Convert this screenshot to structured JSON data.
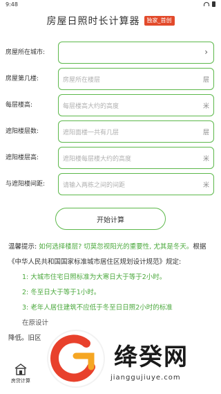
{
  "status_bar": {
    "time": "9:48"
  },
  "header": {
    "title": "房屋日照时长计算器",
    "badge": "独家_首创"
  },
  "form": {
    "rows": [
      {
        "label": "房屋所在城市:",
        "placeholder": "",
        "unit": "",
        "chevron": "›"
      },
      {
        "label": "房屋第几楼:",
        "placeholder": "房屋所在楼层",
        "unit": "层"
      },
      {
        "label": "每层楼高:",
        "placeholder": "每层楼高大约的高度",
        "unit": "米"
      },
      {
        "label": "遮阳楼层数:",
        "placeholder": "遮阳面楼一共有几层",
        "unit": "层"
      },
      {
        "label": "遮阳楼层高:",
        "placeholder": "遮阳楼每层楼大约的高度",
        "unit": "米"
      },
      {
        "label": "与遮阳楼间距:",
        "placeholder": "请输入两栋之间的间距",
        "unit": "米"
      }
    ],
    "submit_label": "开始计算"
  },
  "tips": {
    "prefix": "温馨提示: ",
    "highlight": "如何选择楼层? 切莫忽视阳光的重要性, 尤其是冬天。",
    "body": "根据《中华人民共和国国家标准城市居住区规划设计规范》规定:",
    "items": [
      "1: 大城市住宅日照标准为大寒日大于等于2小时。",
      "2: 冬至日大于等于1小时。",
      "3: 老年人居住建筑不应低于冬至日日照2小时的标准"
    ],
    "tail": "在原设计",
    "tail2": "降低。旧区"
  },
  "bottom_nav": {
    "item_label": "房贷计算"
  },
  "watermark": {
    "text": "绛癸网",
    "url": "jianggujiuye.com"
  },
  "colors": {
    "accent": "#5cb84a",
    "badge": "#e24a2b",
    "tip_green": "#4aa83c"
  }
}
